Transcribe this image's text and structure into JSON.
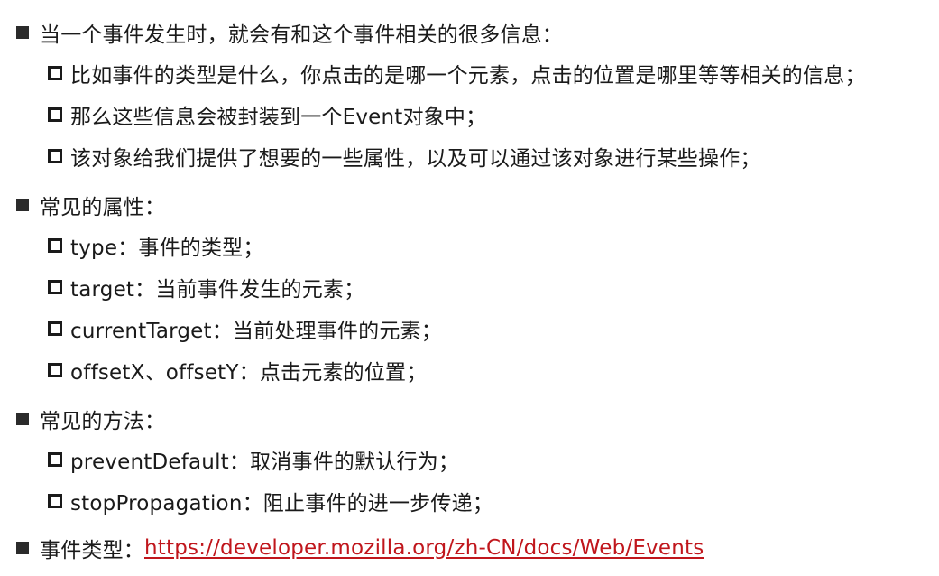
{
  "sections": [
    {
      "heading": "当一个事件发生时，就会有和这个事件相关的很多信息：",
      "items": [
        "比如事件的类型是什么，你点击的是哪一个元素，点击的位置是哪里等等相关的信息；",
        "那么这些信息会被封装到一个Event对象中；",
        "该对象给我们提供了想要的一些属性，以及可以通过该对象进行某些操作；"
      ]
    },
    {
      "heading": "常见的属性：",
      "items": [
        "type：事件的类型；",
        "target：当前事件发生的元素；",
        "currentTarget：当前处理事件的元素；",
        "offsetX、offsetY：点击元素的位置；"
      ]
    },
    {
      "heading": "常见的方法：",
      "items": [
        "preventDefault：取消事件的默认行为；",
        "stopPropagation：阻止事件的进一步传递；"
      ]
    }
  ],
  "event_types": {
    "label": "事件类型：",
    "link": "https://developer.mozilla.org/zh-CN/docs/Web/Events"
  },
  "colors": {
    "link": "#c0161c",
    "text": "#1a1a1a"
  }
}
